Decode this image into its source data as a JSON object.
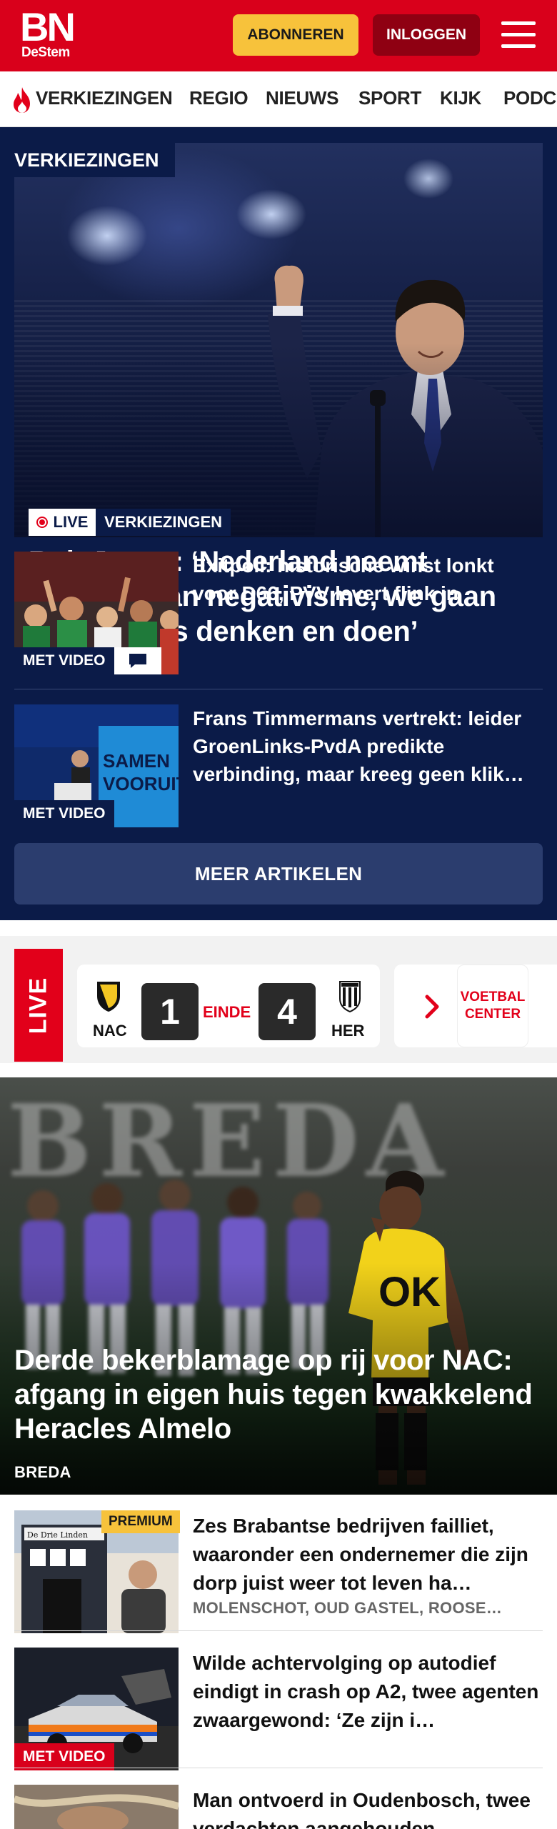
{
  "header": {
    "logo_main": "BN",
    "logo_sub": "DeStem",
    "subscribe_label": "ABONNEREN",
    "login_label": "INLOGGEN",
    "menu_icon": "hamburger-icon"
  },
  "nav": {
    "items": [
      "VERKIEZINGEN",
      "REGIO",
      "NIEUWS",
      "SPORT",
      "KIJK",
      "PODC"
    ],
    "trending_icon": "flame-icon"
  },
  "elections": {
    "section_label": "VERKIEZINGEN",
    "hero": {
      "live_label": "LIVE",
      "category": "VERKIEZINGEN",
      "title": "Rob Jetten: ‘Nederland neemt afscheid van negativisme, we gaan weer groots denken en doen’"
    },
    "articles": [
      {
        "title": "Exitpoll: historische winst lonkt voor D66, PVV levert flink in",
        "badge": "MET VIDEO",
        "comment_icon": "comment-icon"
      },
      {
        "title": "Frans Timmermans vertrekt: leider GroenLinks-PvdA predikte verbinding, maar kreeg geen klik…",
        "badge": "MET VIDEO",
        "thumb_text": "SAMEN VOORUIT"
      }
    ],
    "more_label": "MEER ARTIKELEN"
  },
  "scores": {
    "live_label": "LIVE",
    "match": {
      "home": "NAC",
      "away": "HER",
      "home_score": "1",
      "away_score": "4",
      "status": "EINDE"
    },
    "center_label": "VOETBAL CENTER",
    "colors": {
      "live": "#e2001a",
      "status": "#e2001a"
    }
  },
  "sport_hero": {
    "stand_text": "BREDA",
    "shirt_text": "OK",
    "title": "Derde bekerblamage op rij voor NAC: afgang in eigen huis tegen kwakkelend Heracles Almelo",
    "location": "BREDA"
  },
  "list": [
    {
      "title": "Zes Brabantse bedrijven failliet, waaronder een ondernemer die zijn dorp juist weer tot leven ha…",
      "meta": "MOLENSCHOT, OUD GASTEL, ROOSE…",
      "badge": "PREMIUM",
      "thumb_sign": "De Drie Linden"
    },
    {
      "title": "Wilde achtervolging op autodief eindigt in crash op A2, twee agenten zwaargewond: ‘Ze zijn i…",
      "badge": "MET VIDEO"
    },
    {
      "title": "Man ontvoerd in Oudenbosch, twee verdachten aangehouden"
    }
  ],
  "colors": {
    "brand_red": "#d9001b",
    "navy": "#0b1b48",
    "subscribe_yellow": "#f7c23b",
    "login_dark_red": "#8f0012",
    "more_button": "#2b3d6e"
  }
}
